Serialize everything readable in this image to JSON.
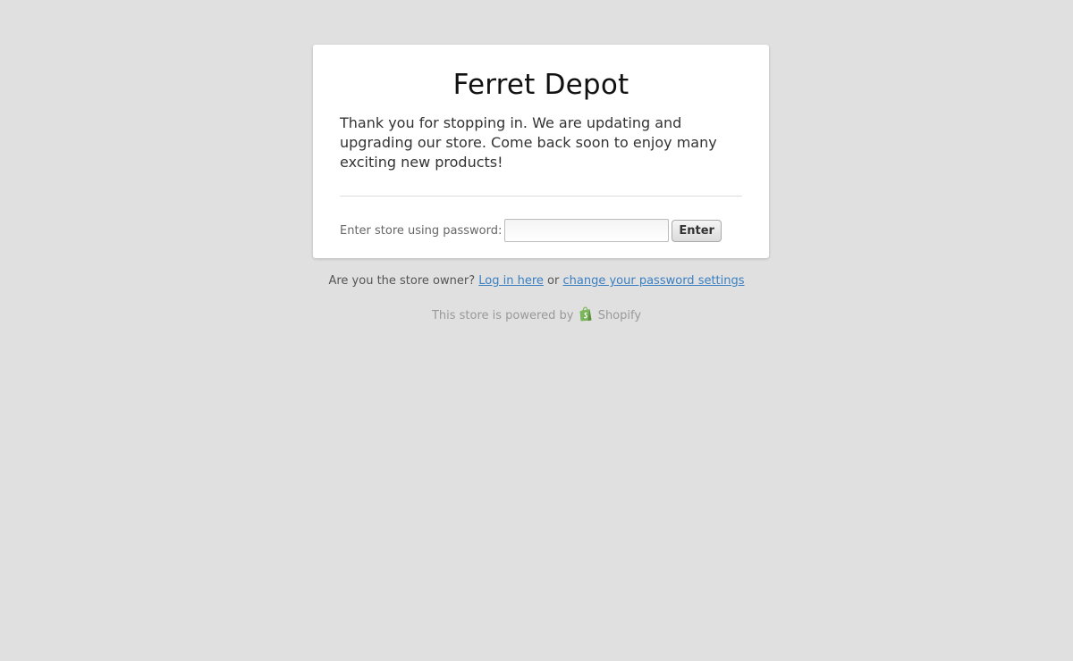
{
  "store": {
    "title": "Ferret Depot",
    "message": "Thank you for stopping in. We are updating and upgrading our store. Come back soon to enjoy many exciting new products!"
  },
  "password_form": {
    "label": "Enter store using password:",
    "value": "",
    "button_label": "Enter"
  },
  "owner": {
    "prompt": "Are you the store owner?",
    "login_link": "Log in here",
    "separator": "or",
    "settings_link": "change your password settings"
  },
  "footer": {
    "powered_by": "This store is powered by",
    "brand": "Shopify",
    "brand_icon": "shopify-bag-icon"
  },
  "colors": {
    "background": "#e0e0e0",
    "link": "#3a7fc1",
    "shopify_green": "#7ab55c"
  }
}
